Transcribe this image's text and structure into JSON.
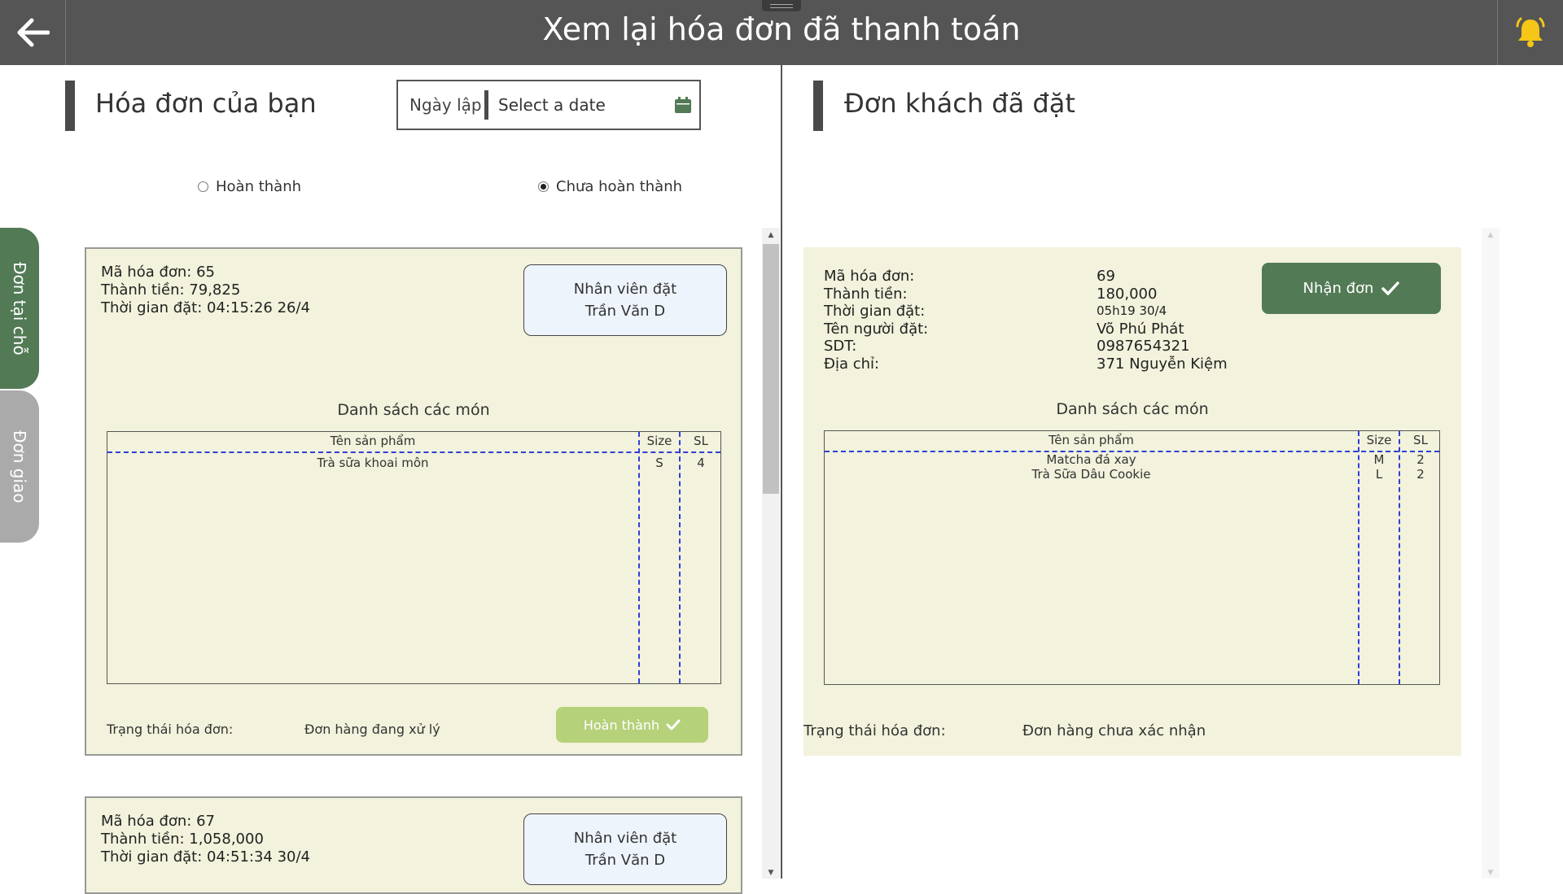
{
  "header": {
    "title": "Xem lại hóa đơn đã thanh toán",
    "back_icon": "arrow-left-icon",
    "bell_icon": "bell-icon"
  },
  "left": {
    "title": "Hóa đơn của bạn",
    "date_filter": {
      "label": "Ngày lập",
      "placeholder": "Select a date",
      "icon": "calendar-icon"
    },
    "radio_options": [
      {
        "label": "Hoàn thành",
        "checked": false
      },
      {
        "label": "Chưa hoàn thành",
        "checked": true
      }
    ],
    "side_tabs": [
      {
        "label": "Đơn tại chỗ",
        "active": true,
        "color": "#527a55"
      },
      {
        "label": "Đơn giao",
        "active": false,
        "color": "#aaaaaa"
      }
    ],
    "invoices": [
      {
        "info_lines": [
          "Mã hóa đơn: 65",
          "Thành tiền: 79,825",
          "Thời gian đặt: 04:15:26 26/4"
        ],
        "employee_label": "Nhân viên đặt",
        "employee_name": "Trần Văn D",
        "list_title": "Danh sách các món",
        "columns": [
          "Tên sản phẩm",
          "Size",
          "SL"
        ],
        "items": [
          {
            "name": "Trà sữa khoai môn",
            "size": "S",
            "qty": "4"
          }
        ],
        "status_label": "Trạng thái hóa đơn:",
        "status_value": "Đơn hàng đang xử lý",
        "action_label": "Hoàn thành"
      },
      {
        "info_lines": [
          "Mã hóa đơn: 67",
          "Thành tiền: 1,058,000",
          "Thời gian đặt: 04:51:34 30/4"
        ],
        "employee_label": "Nhân viên đặt",
        "employee_name": "Trần Văn D"
      }
    ]
  },
  "right": {
    "title": "Đơn khách đã đặt",
    "order": {
      "fields": [
        {
          "label": "Mã hóa đơn:",
          "value": "69"
        },
        {
          "label": "Thành tiền:",
          "value": "180,000"
        },
        {
          "label": "Thời gian đặt:",
          "value": "05h19 30/4"
        },
        {
          "label": "Tên người đặt:",
          "value": "Võ Phú Phát"
        },
        {
          "label": "SDT:",
          "value": "0987654321"
        },
        {
          "label": "Địa chỉ:",
          "value": "371 Nguyễn Kiệm"
        }
      ],
      "action_label": "Nhận đơn",
      "list_title": "Danh sách các món",
      "columns": [
        "Tên sản phẩm",
        "Size",
        "SL"
      ],
      "items": [
        {
          "name": "Matcha đá xay",
          "size": "M",
          "qty": "2"
        },
        {
          "name": "Trà Sữa Dâu Cookie",
          "size": "L",
          "qty": "2"
        }
      ],
      "status_label": "Trạng thái hóa đơn:",
      "status_value": "Đơn hàng chưa xác nhận"
    }
  },
  "colors": {
    "header_bg": "#555555",
    "card_bg": "#f3f2dc",
    "accent_green": "#527a55",
    "done_green": "#b5d17a",
    "bell": "#f5c518"
  }
}
